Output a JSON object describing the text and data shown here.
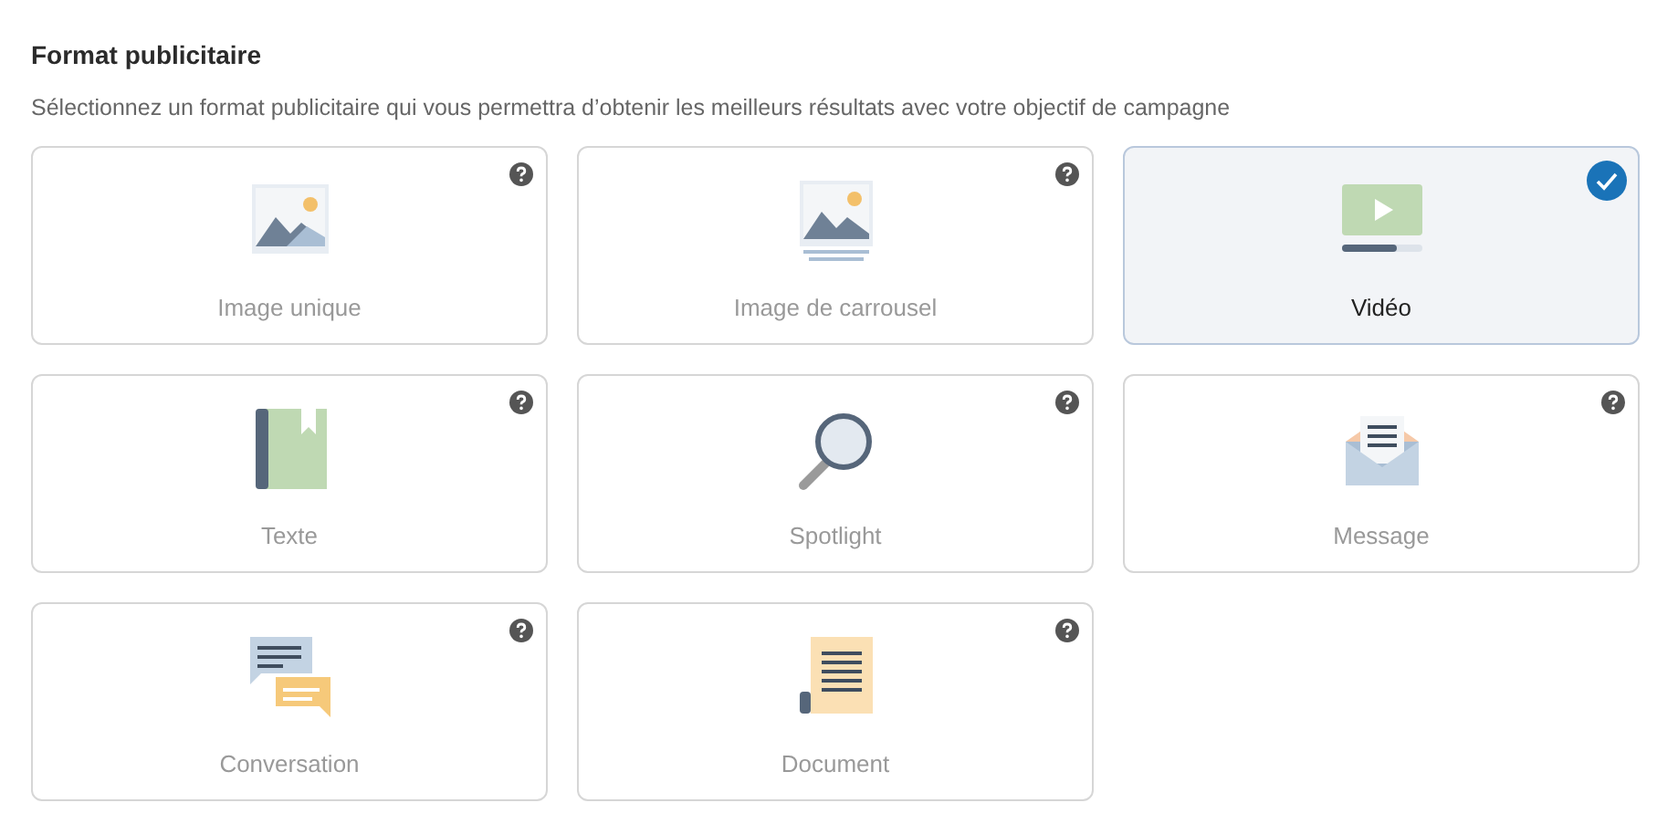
{
  "title": "Format publicitaire",
  "description": "Sélectionnez un format publicitaire qui vous permettra d’obtenir les meilleurs résultats avec votre objectif de campagne",
  "formats": [
    {
      "kind": "image",
      "label": "Image unique",
      "selected": false
    },
    {
      "kind": "carousel",
      "label": "Image de carrousel",
      "selected": false
    },
    {
      "kind": "video",
      "label": "Vidéo",
      "selected": true
    },
    {
      "kind": "text",
      "label": "Texte",
      "selected": false
    },
    {
      "kind": "spotlight",
      "label": "Spotlight",
      "selected": false
    },
    {
      "kind": "message",
      "label": "Message",
      "selected": false
    },
    {
      "kind": "conversation",
      "label": "Conversation",
      "selected": false
    },
    {
      "kind": "document",
      "label": "Document",
      "selected": false
    }
  ]
}
